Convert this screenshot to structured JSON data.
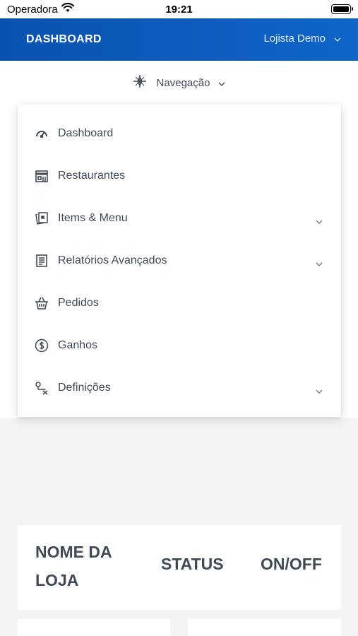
{
  "status_bar": {
    "carrier": "Operadora",
    "time": "19:21"
  },
  "header": {
    "brand": "DASHBOARD",
    "user": "Lojista Demo"
  },
  "nav_toggle": {
    "label": "Navegação"
  },
  "menu": {
    "items": [
      {
        "label": "Dashboard",
        "icon": "gauge-icon",
        "has_submenu": false
      },
      {
        "label": "Restaurantes",
        "icon": "store-icon",
        "has_submenu": false
      },
      {
        "label": "Items & Menu",
        "icon": "cards-icon",
        "has_submenu": true
      },
      {
        "label": "Relatórios Avançados",
        "icon": "report-icon",
        "has_submenu": true
      },
      {
        "label": "Pedidos",
        "icon": "basket-icon",
        "has_submenu": false
      },
      {
        "label": "Ganhos",
        "icon": "dollar-icon",
        "has_submenu": false
      },
      {
        "label": "Definições",
        "icon": "settings-route-icon",
        "has_submenu": true
      }
    ]
  },
  "table_header": {
    "col1": "NOME DA LOJA",
    "col2": "STATUS",
    "col3": "ON/OFF"
  },
  "colors": {
    "header_bg": "#0a52ae",
    "text": "#3f4a56",
    "page_bg": "#f3f4f6"
  }
}
